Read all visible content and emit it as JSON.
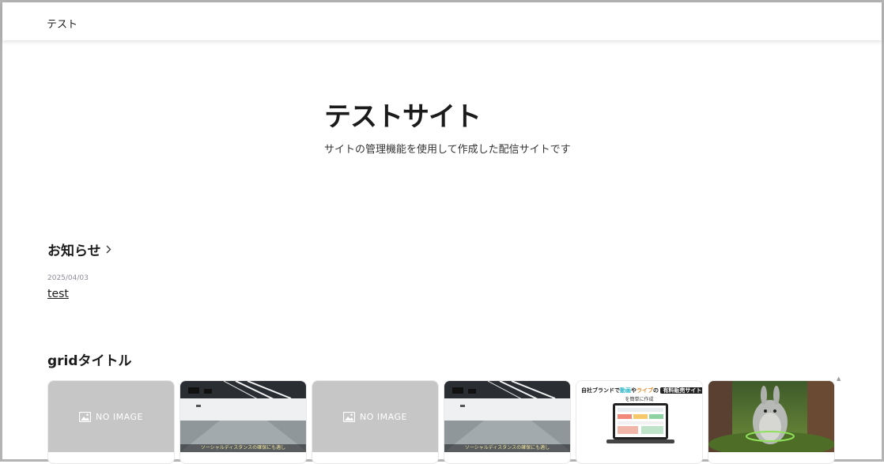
{
  "header": {
    "site_name": "テスト"
  },
  "hero": {
    "title": "テストサイト",
    "description": "サイトの管理機能を使用して作成した配信サイトです"
  },
  "news": {
    "heading": "お知らせ",
    "items": [
      {
        "date": "2025/04/03",
        "title": "test"
      }
    ]
  },
  "grid": {
    "title": "gridタイトル",
    "cards": [
      {
        "type": "no-image",
        "label": "NO IMAGE"
      },
      {
        "type": "studio-photo",
        "caption": "ソーシャルディスタンスの確保にも適し"
      },
      {
        "type": "no-image",
        "label": "NO IMAGE"
      },
      {
        "type": "studio-photo",
        "caption": "ソーシャルディスタンスの確保にも適し"
      },
      {
        "type": "promo",
        "promo_prefix": "自社ブランドで",
        "promo_hl1": "動画",
        "promo_mid1": "や",
        "promo_hl2": "ライブ",
        "promo_mid2": "の",
        "promo_badge": "有料販売サイト",
        "promo_sub": "を簡単に作成"
      },
      {
        "type": "animation-still"
      }
    ]
  },
  "colors": {
    "date_text": "#8c8c9a",
    "no_image_bg": "#c6c6c6",
    "promo_accent_1": "#27b5c8",
    "promo_accent_2": "#e58a2a"
  }
}
